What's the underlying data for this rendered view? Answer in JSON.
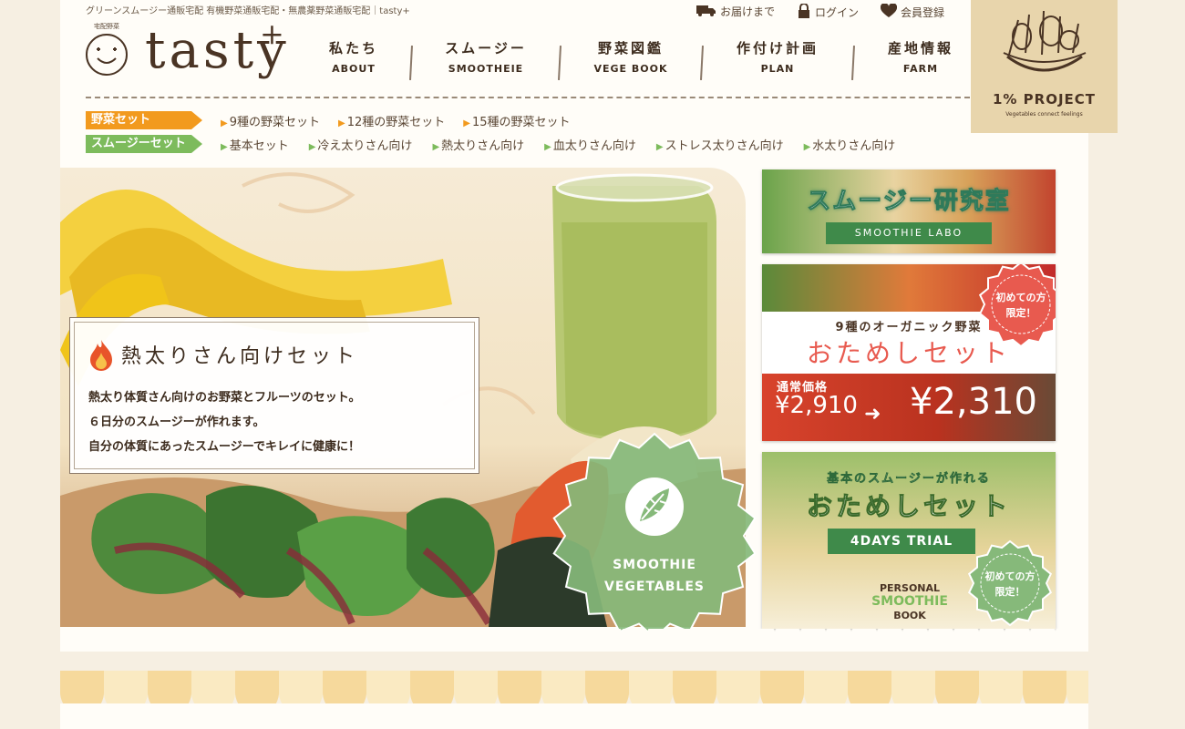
{
  "header": {
    "tagline": "グリーンスムージー通販宅配 有機野菜通販宅配・無農薬野菜通販宅配｜tasty+",
    "util_links": [
      {
        "label": "お届けまで",
        "icon": "truck-icon"
      },
      {
        "label": "ログイン",
        "icon": "lock-icon"
      },
      {
        "label": "会員登録",
        "icon": "heart-icon"
      }
    ],
    "logo": {
      "small": "宅配野菜",
      "text": "tasty",
      "plus": "+"
    },
    "nav": [
      {
        "jp": "私たち",
        "en": "ABOUT"
      },
      {
        "jp": "スムージー",
        "en": "SMOOTHEIE"
      },
      {
        "jp": "野菜図鑑",
        "en": "VEGE BOOK"
      },
      {
        "jp": "作付け計画",
        "en": "PLAN"
      },
      {
        "jp": "産地情報",
        "en": "FARM"
      }
    ],
    "project_badge": {
      "title": "1% PROJECT",
      "subtitle": "Vegetables connect feelings"
    }
  },
  "categories": [
    {
      "label": "野菜セット",
      "color": "#f29a1e",
      "links": [
        "9種の野菜セット",
        "12種の野菜セット",
        "15種の野菜セット"
      ]
    },
    {
      "label": "スムージーセット",
      "color": "#7dbb5c",
      "links": [
        "基本セット",
        "冷え太りさん向け",
        "熱太りさん向け",
        "血太りさん向け",
        "ストレス太りさん向け",
        "水太りさん向け"
      ]
    }
  ],
  "hero": {
    "title": "熱太りさん向けセット",
    "lines": [
      "熱太り体質さん向けのお野菜とフルーツのセット。",
      "６日分のスムージーが作れます。",
      "自分の体質にあったスムージーでキレイに健康に！"
    ],
    "seal_line1": "SMOOTHIE",
    "seal_line2": "VEGETABLES"
  },
  "sidebar": {
    "labo": {
      "title": "スムージー研究室",
      "ribbon": "SMOOTHIE LABO"
    },
    "trial9": {
      "subtitle": "9種のオーガニック野菜",
      "title": "おためしセット",
      "badge1": "初めての方",
      "badge2": "限定！",
      "regular_label": "通常価格",
      "old_price": "¥2,910",
      "new_price": "¥2,310"
    },
    "trial4": {
      "subtitle": "基本のスムージーが作れる",
      "title": "おためしセット",
      "ribbon": "4DAYS TRIAL",
      "badge1": "初めての方",
      "badge2": "限定！",
      "book1": "PERSONAL",
      "book2": "SMOOTHIE",
      "book3": "BOOK"
    }
  },
  "colors": {
    "orange": "#f29a1e",
    "green": "#7dbb5c",
    "seal": "#86b97a",
    "red_badge": "#e85a4f",
    "brown": "#4a3424"
  }
}
